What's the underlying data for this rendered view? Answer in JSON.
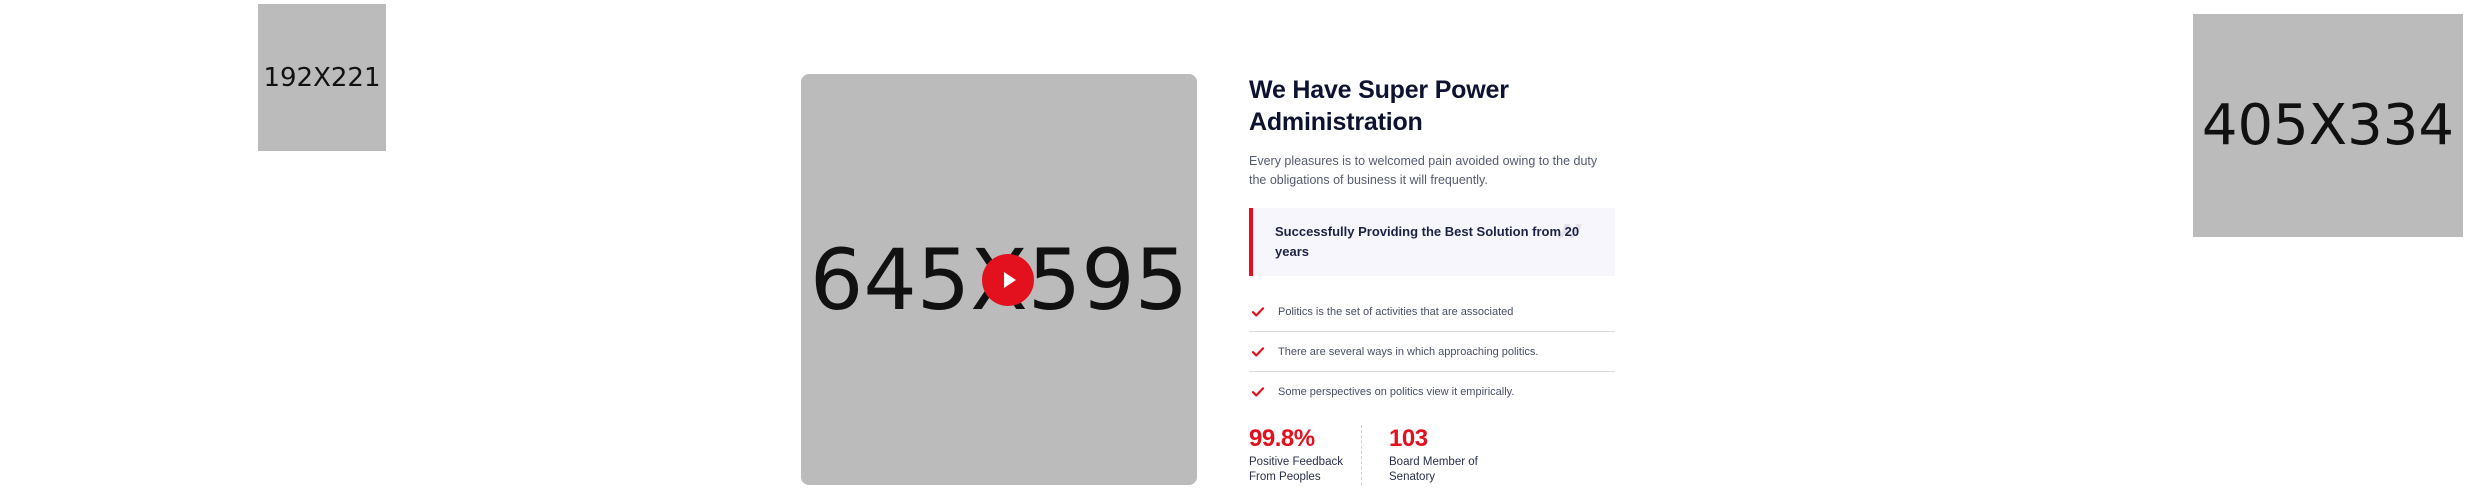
{
  "placeholders": {
    "small": "192X221",
    "right": "405X334",
    "video": "645X595"
  },
  "colors": {
    "accent": "#e3101e",
    "heading": "#0d1231",
    "placeholder_bg": "#bbbbbb",
    "highlight_bg": "#f7f6fc"
  },
  "video": {
    "play_icon": "play-icon"
  },
  "about": {
    "heading": "We Have Super Power Administration",
    "intro": "Every pleasures is to welcomed pain avoided owing to the duty the obligations of business it will frequently.",
    "highlight": "Successfully Providing the Best Solution from 20 years",
    "quote_icon": "quote-icon",
    "features": [
      {
        "icon": "check-icon",
        "text": "Politics is the set of activities that are associated"
      },
      {
        "icon": "check-icon",
        "text": "There are several ways in which approaching politics."
      },
      {
        "icon": "check-icon",
        "text": "Some perspectives on politics view it empirically."
      }
    ],
    "stats": [
      {
        "value": "99.8%",
        "label": "Positive Feedback From Peoples"
      },
      {
        "value": "103",
        "label": "Board Member of Senatory"
      }
    ]
  }
}
